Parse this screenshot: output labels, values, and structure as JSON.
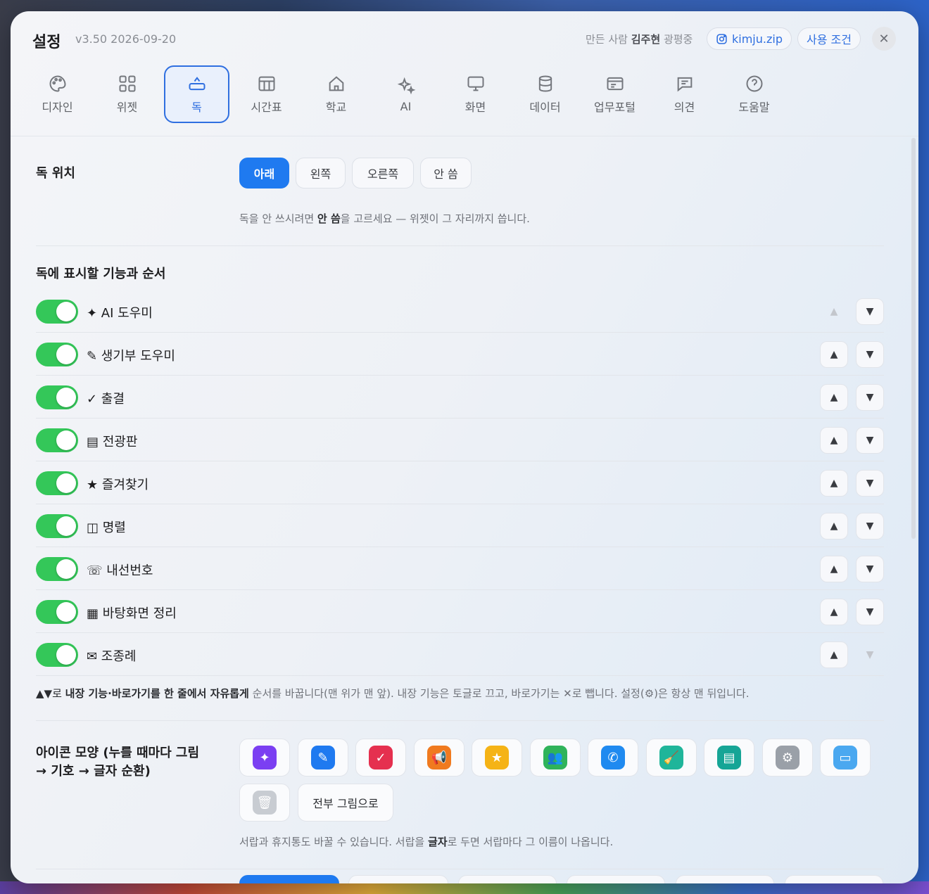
{
  "header": {
    "title": "설정",
    "version": "v3.50 2026-09-20",
    "maker_prefix": "만든 사람",
    "maker_name": "김주현",
    "maker_school": "광평중",
    "instagram": "kimju.zip",
    "terms": "사용 조건",
    "close": "✕"
  },
  "tabs": [
    {
      "label": "디자인",
      "icon": "palette-icon"
    },
    {
      "label": "위젯",
      "icon": "grid-icon"
    },
    {
      "label": "독",
      "icon": "dock-icon",
      "active": true
    },
    {
      "label": "시간표",
      "icon": "table-icon"
    },
    {
      "label": "학교",
      "icon": "school-icon"
    },
    {
      "label": "AI",
      "icon": "sparkle-icon"
    },
    {
      "label": "화면",
      "icon": "monitor-icon"
    },
    {
      "label": "데이터",
      "icon": "database-icon"
    },
    {
      "label": "업무포털",
      "icon": "portal-icon"
    },
    {
      "label": "의견",
      "icon": "chat-icon"
    },
    {
      "label": "도움말",
      "icon": "help-icon"
    }
  ],
  "dock_position": {
    "label": "독 위치",
    "options": [
      "아래",
      "왼쪽",
      "오른쪽",
      "안 씀"
    ],
    "selected": "아래",
    "hint_pre": "독을 안 쓰시려면",
    "hint_bold": "안 씀",
    "hint_post": "을 고르세요 — 위젯이 그 자리까지 씁니다."
  },
  "dock_items": {
    "label": "독에 표시할 기능과 순서",
    "items": [
      {
        "label": "✦ AI 도우미",
        "enabled": true
      },
      {
        "label": "✎ 생기부 도우미",
        "enabled": true
      },
      {
        "label": "✓ 출결",
        "enabled": true
      },
      {
        "label": "▤ 전광판",
        "enabled": true
      },
      {
        "label": "★ 즐겨찾기",
        "enabled": true
      },
      {
        "label": "◫ 명렬",
        "enabled": true
      },
      {
        "label": "☏ 내선번호",
        "enabled": true
      },
      {
        "label": "▦ 바탕화면 정리",
        "enabled": true
      },
      {
        "label": "✉ 조종례",
        "enabled": true
      }
    ],
    "up_symbol": "▲",
    "down_symbol": "▼",
    "hint_pre": "▲▼로",
    "hint_bold": "내장 기능·바로가기를 한 줄에서 자유롭게",
    "hint_post": "순서를 바꿉니다(맨 위가 맨 앞). 내장 기능은 토글로 끄고, 바로가기는 ✕로 뺍니다. 설정(⚙)은 항상 맨 뒤입니다."
  },
  "icon_style": {
    "label_line1": "아이콘 모양 (누를 때마다 그림",
    "label_line2": "→ 기호 → 글자 순환)",
    "icons": [
      {
        "name": "ai-sparkle-icon",
        "color": "#7b3ff2",
        "glyph": "✦"
      },
      {
        "name": "pen-icon",
        "color": "#1f7af0",
        "glyph": "✎"
      },
      {
        "name": "checklist-icon",
        "color": "#e5304f",
        "glyph": "✓"
      },
      {
        "name": "megaphone-icon",
        "color": "#f07a1f",
        "glyph": "📢"
      },
      {
        "name": "star-icon",
        "color": "#f5b316",
        "glyph": "★"
      },
      {
        "name": "people-icon",
        "color": "#2fb35a",
        "glyph": "👥"
      },
      {
        "name": "phone-icon",
        "color": "#1f8af0",
        "glyph": "✆"
      },
      {
        "name": "broom-icon",
        "color": "#1fb59a",
        "glyph": "🧹"
      },
      {
        "name": "message-icon",
        "color": "#16a596",
        "glyph": "▤"
      },
      {
        "name": "settings-icon",
        "color": "#9aa0a8",
        "glyph": "⚙"
      },
      {
        "name": "folder-icon",
        "color": "#4aa8f0",
        "glyph": "▭"
      },
      {
        "name": "trash-icon",
        "color": "#c8ccd2",
        "glyph": "🗑"
      }
    ],
    "all_button": "전부 그림으로",
    "hint_pre": "서랍과 휴지통도 바꿀 수 있습니다. 서랍을",
    "hint_bold": "글자",
    "hint_post": "로 두면 서랍마다 그 이름이 나옵니다."
  }
}
